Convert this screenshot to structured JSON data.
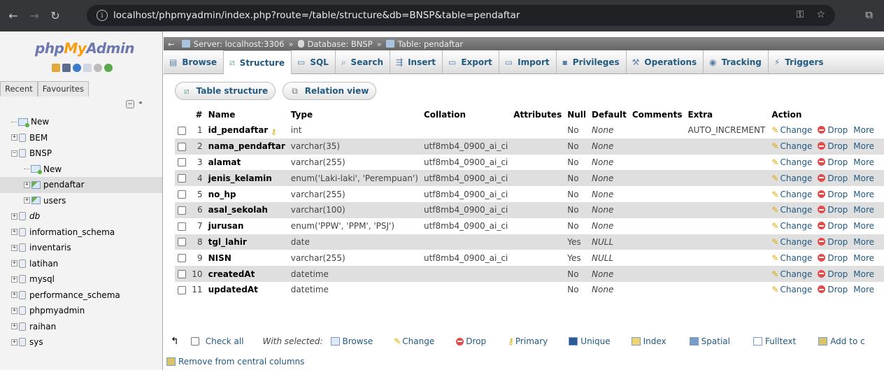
{
  "browser": {
    "url": "localhost/phpmyadmin/index.php?route=/table/structure&db=BNSP&table=pendaftar"
  },
  "logo": {
    "php": "php",
    "my": "My",
    "admin": "Admin"
  },
  "nav_tabs": {
    "recent": "Recent",
    "favourites": "Favourites"
  },
  "tree": [
    {
      "label": "New",
      "kind": "new"
    },
    {
      "label": "BEM",
      "kind": "db"
    },
    {
      "label": "BNSP",
      "kind": "db"
    },
    {
      "label": "New",
      "kind": "new-sub"
    },
    {
      "label": "pendaftar",
      "kind": "table"
    },
    {
      "label": "users",
      "kind": "table"
    },
    {
      "label": "db",
      "kind": "db-italic"
    },
    {
      "label": "information_schema",
      "kind": "db"
    },
    {
      "label": "inventaris",
      "kind": "db"
    },
    {
      "label": "latihan",
      "kind": "db"
    },
    {
      "label": "mysql",
      "kind": "db"
    },
    {
      "label": "performance_schema",
      "kind": "db"
    },
    {
      "label": "phpmyadmin",
      "kind": "db"
    },
    {
      "label": "raihan",
      "kind": "db"
    },
    {
      "label": "sys",
      "kind": "db"
    }
  ],
  "breadcrumb": {
    "server": "Server: localhost:3306",
    "database": "Database: BNSP",
    "table": "Table: pendaftar",
    "sep": "»"
  },
  "menu": {
    "browse": "Browse",
    "structure": "Structure",
    "sql": "SQL",
    "search": "Search",
    "insert": "Insert",
    "export": "Export",
    "import": "Import",
    "privileges": "Privileges",
    "operations": "Operations",
    "tracking": "Tracking",
    "triggers": "Triggers"
  },
  "subtabs": {
    "table_structure": "Table structure",
    "relation_view": "Relation view"
  },
  "columns": {
    "num": "#",
    "name": "Name",
    "type": "Type",
    "collation": "Collation",
    "attributes": "Attributes",
    "null": "Null",
    "default": "Default",
    "comments": "Comments",
    "extra": "Extra",
    "action": "Action"
  },
  "rows": [
    {
      "num": "1",
      "name": "id_pendaftar",
      "type": "int",
      "collation": "",
      "null": "No",
      "default": "None",
      "extra": "AUTO_INCREMENT",
      "key": true
    },
    {
      "num": "2",
      "name": "nama_pendaftar",
      "type": "varchar(35)",
      "collation": "utf8mb4_0900_ai_ci",
      "null": "No",
      "default": "None",
      "extra": ""
    },
    {
      "num": "3",
      "name": "alamat",
      "type": "varchar(255)",
      "collation": "utf8mb4_0900_ai_ci",
      "null": "No",
      "default": "None",
      "extra": ""
    },
    {
      "num": "4",
      "name": "jenis_kelamin",
      "type": "enum('Laki-laki', 'Perempuan')",
      "collation": "utf8mb4_0900_ai_ci",
      "null": "No",
      "default": "None",
      "extra": ""
    },
    {
      "num": "5",
      "name": "no_hp",
      "type": "varchar(255)",
      "collation": "utf8mb4_0900_ai_ci",
      "null": "No",
      "default": "None",
      "extra": ""
    },
    {
      "num": "6",
      "name": "asal_sekolah",
      "type": "varchar(100)",
      "collation": "utf8mb4_0900_ai_ci",
      "null": "No",
      "default": "None",
      "extra": ""
    },
    {
      "num": "7",
      "name": "jurusan",
      "type": "enum('PPW', 'PPM', 'PSJ')",
      "collation": "utf8mb4_0900_ai_ci",
      "null": "No",
      "default": "None",
      "extra": ""
    },
    {
      "num": "8",
      "name": "tgl_lahir",
      "type": "date",
      "collation": "",
      "null": "Yes",
      "default": "NULL",
      "extra": ""
    },
    {
      "num": "9",
      "name": "NISN",
      "type": "varchar(255)",
      "collation": "utf8mb4_0900_ai_ci",
      "null": "Yes",
      "default": "NULL",
      "extra": ""
    },
    {
      "num": "10",
      "name": "createdAt",
      "type": "datetime",
      "collation": "",
      "null": "No",
      "default": "None",
      "extra": ""
    },
    {
      "num": "11",
      "name": "updatedAt",
      "type": "datetime",
      "collation": "",
      "null": "No",
      "default": "None",
      "extra": ""
    }
  ],
  "actions": {
    "change": "Change",
    "drop": "Drop",
    "more": "More"
  },
  "bottom": {
    "check_all": "Check all",
    "with_selected": "With selected:",
    "browse": "Browse",
    "change": "Change",
    "drop": "Drop",
    "primary": "Primary",
    "unique": "Unique",
    "index": "Index",
    "spatial": "Spatial",
    "fulltext": "Fulltext",
    "add_to_central": "Add to c",
    "remove_central": "Remove from central columns"
  }
}
